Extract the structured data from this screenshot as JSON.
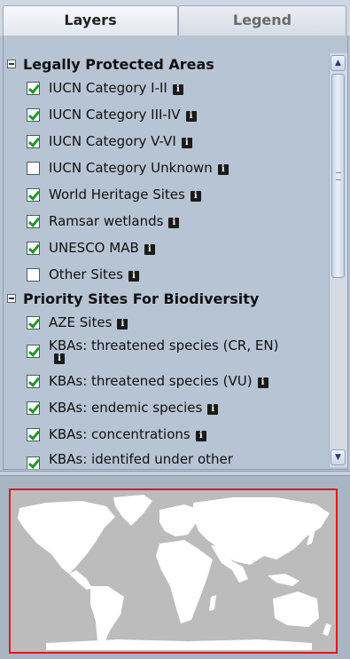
{
  "tabs": [
    {
      "label": "Layers",
      "active": true
    },
    {
      "label": "Legend",
      "active": false
    }
  ],
  "info_glyph": "i",
  "groups": [
    {
      "title": "Legally Protected Areas",
      "items": [
        {
          "label": "IUCN Category I-II",
          "checked": true
        },
        {
          "label": "IUCN Category III-IV",
          "checked": true
        },
        {
          "label": "IUCN Category V-VI",
          "checked": true
        },
        {
          "label": "IUCN Category Unknown",
          "checked": false
        },
        {
          "label": "World Heritage Sites",
          "checked": true
        },
        {
          "label": "Ramsar wetlands",
          "checked": true
        },
        {
          "label": "UNESCO MAB",
          "checked": true
        },
        {
          "label": "Other Sites",
          "checked": false
        }
      ]
    },
    {
      "title": "Priority Sites For Biodiversity",
      "items": [
        {
          "label": "AZE Sites",
          "checked": true
        },
        {
          "label": "KBAs: threatened species (CR, EN)",
          "checked": true
        },
        {
          "label": "KBAs: threatened species (VU)",
          "checked": true
        },
        {
          "label": "KBAs: endemic species",
          "checked": true
        },
        {
          "label": "KBAs: concentrations",
          "checked": true
        },
        {
          "label": "KBAs: identifed under other",
          "checked": true
        }
      ]
    }
  ],
  "colors": {
    "panel_bg": "#b7c4d4",
    "checkmark": "#1d9a24",
    "map_frame": "#e01818",
    "map_ocean": "#bcbcbc",
    "map_land": "#ffffff"
  }
}
